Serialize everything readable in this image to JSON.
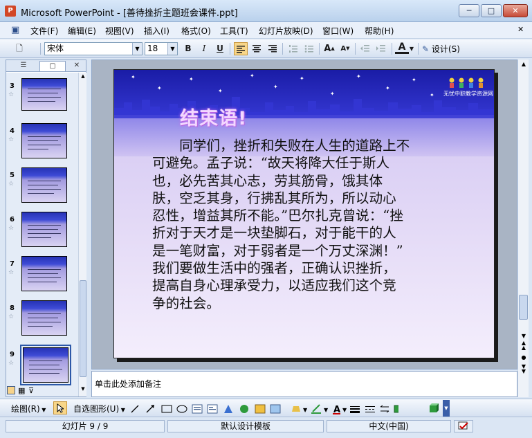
{
  "window": {
    "title": "Microsoft PowerPoint - [善待挫折主题班会课件.ppt]",
    "app_icon_letter": "P",
    "minimize": "─",
    "maximize": "□",
    "close": "✕"
  },
  "menu": {
    "icon": "▣",
    "items": [
      "文件(F)",
      "编辑(E)",
      "视图(V)",
      "插入(I)",
      "格式(O)",
      "工具(T)",
      "幻灯片放映(D)",
      "窗口(W)",
      "帮助(H)"
    ],
    "close_glyph": "✕"
  },
  "toolbar": {
    "new_icon": "🗋",
    "font_name": "宋体",
    "font_size": "18",
    "bold": "B",
    "italic": "I",
    "underline": "U",
    "increase_font": "A",
    "decrease_font": "A",
    "font_color": "A",
    "design_label": "设计(S)"
  },
  "slide_panel": {
    "tab_outline_icon": "☰",
    "tab_slides_icon": "▢",
    "close_glyph": "✕",
    "thumbnails": [
      {
        "number": "3"
      },
      {
        "number": "4"
      },
      {
        "number": "5"
      },
      {
        "number": "6"
      },
      {
        "number": "7"
      },
      {
        "number": "8"
      },
      {
        "number": "9"
      }
    ],
    "star_glyph": "☆"
  },
  "slide": {
    "title": "结束语!",
    "logo_text": "无忧中职教学资源网",
    "body_lines": [
      "　　同学们，挫折和失败在人生的道路上不",
      "可避免。孟子说：“故天将降大任于斯人",
      "也，必先苦其心志，劳其筋骨，饿其体",
      "肤，空乏其身，行拂乱其所为，所以动心",
      "忍性，增益其所不能。”巴尔扎克曾说：“挫",
      "折对于天才是一块垫脚石，对于能干的人",
      "是一笔财富，对于弱者是一个万丈深渊！”",
      "我们要做生活中的强者，正确认识挫折，",
      "提高自身心理承受力，以适应我们这个竞",
      "争的社会。"
    ]
  },
  "notes": {
    "placeholder": "单击此处添加备注"
  },
  "drawing_toolbar": {
    "draw_label": "绘图(R)",
    "autoshapes_label": "自选图形(U)"
  },
  "statusbar": {
    "slide_position": "幻灯片 9 / 9",
    "template": "默认设计模板",
    "language": "中文(中国)"
  }
}
